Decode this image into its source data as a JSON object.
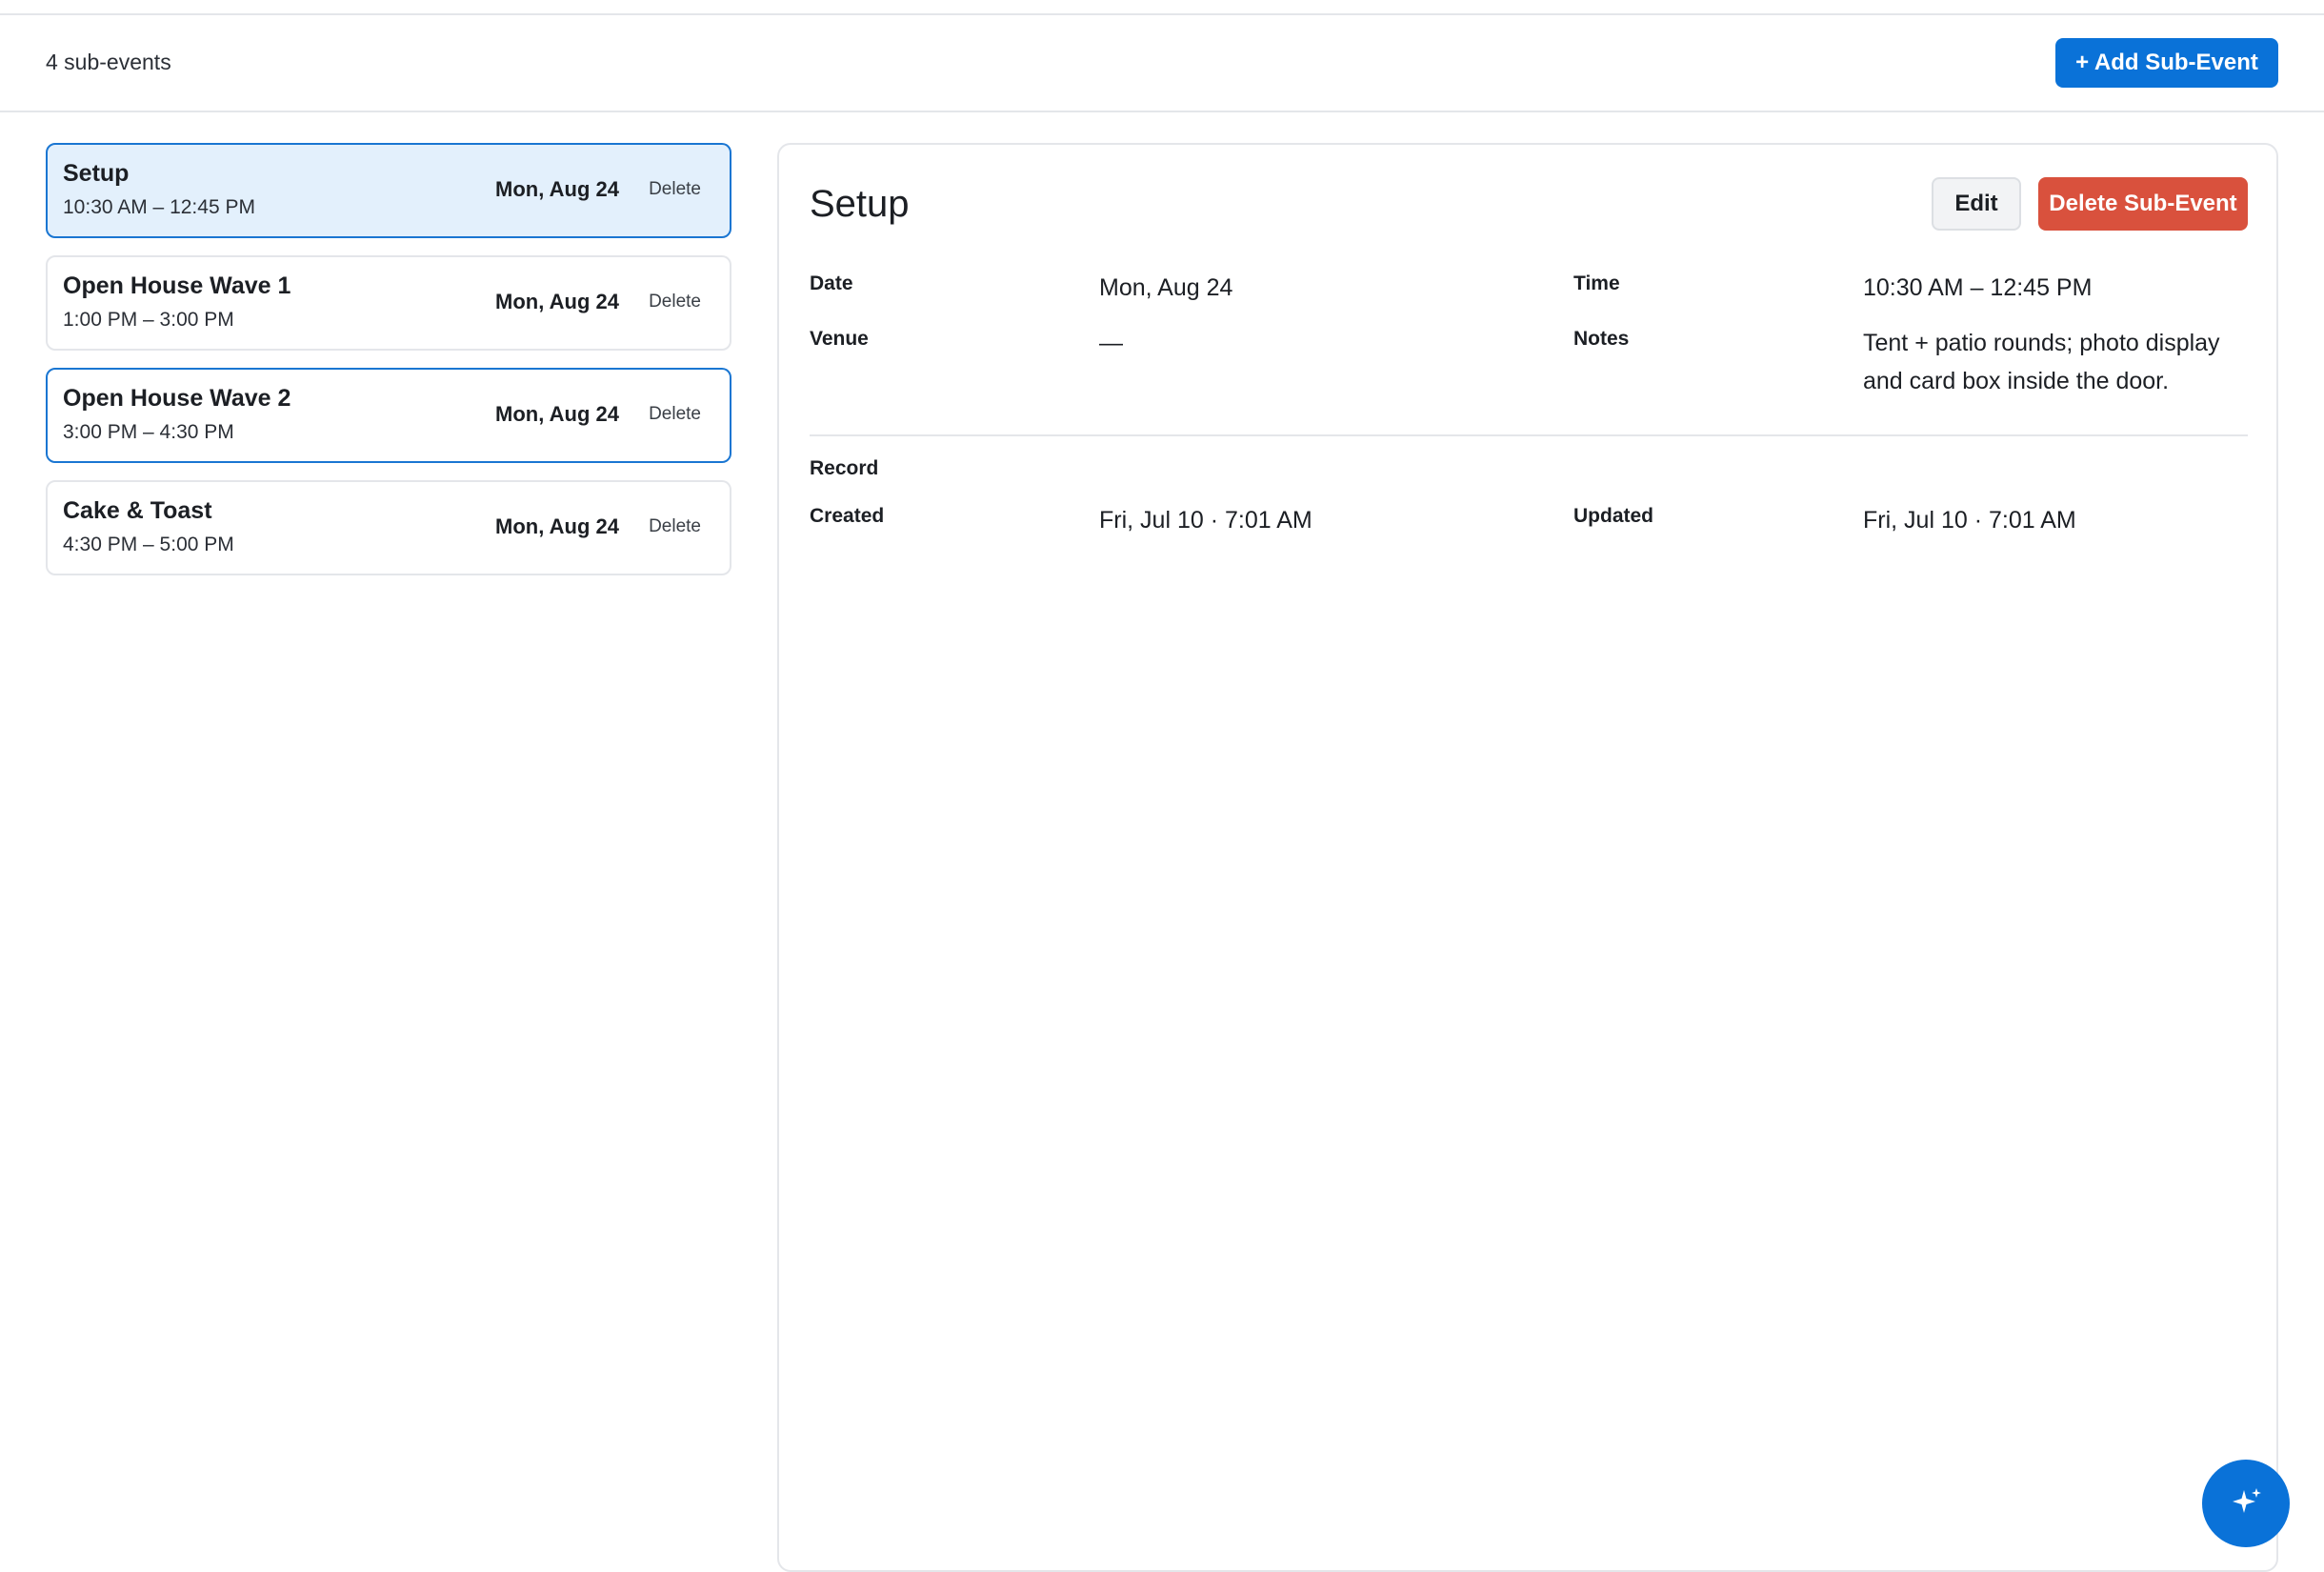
{
  "toolbar": {
    "count_label": "4 sub-events",
    "add_label": "+ Add Sub-Event"
  },
  "sub_events": [
    {
      "title": "Setup",
      "time": "10:30 AM – 12:45 PM",
      "date": "Mon, Aug 24",
      "delete_label": "Delete"
    },
    {
      "title": "Open House Wave 1",
      "time": "1:00 PM – 3:00 PM",
      "date": "Mon, Aug 24",
      "delete_label": "Delete"
    },
    {
      "title": "Open House Wave 2",
      "time": "3:00 PM – 4:30 PM",
      "date": "Mon, Aug 24",
      "delete_label": "Delete"
    },
    {
      "title": "Cake & Toast",
      "time": "4:30 PM – 5:00 PM",
      "date": "Mon, Aug 24",
      "delete_label": "Delete"
    }
  ],
  "detail": {
    "title": "Setup",
    "edit_label": "Edit",
    "delete_label": "Delete Sub-Event",
    "fields": {
      "date_label": "Date",
      "date_value": "Mon, Aug 24",
      "time_label": "Time",
      "time_value": "10:30 AM – 12:45 PM",
      "venue_label": "Venue",
      "venue_value": "—",
      "notes_label": "Notes",
      "notes_value": "Tent + patio rounds; photo display and card box inside the door."
    },
    "record": {
      "section_label": "Record",
      "created_label": "Created",
      "created_value": "Fri, Jul 10 · 7:01 AM",
      "updated_label": "Updated",
      "updated_value": "Fri, Jul 10 · 7:01 AM"
    }
  },
  "icons": {
    "fab": "sparkle-icon"
  },
  "colors": {
    "accent": "#0a72d8",
    "danger": "#d9513d",
    "selected_bg": "#e3f0fc"
  }
}
